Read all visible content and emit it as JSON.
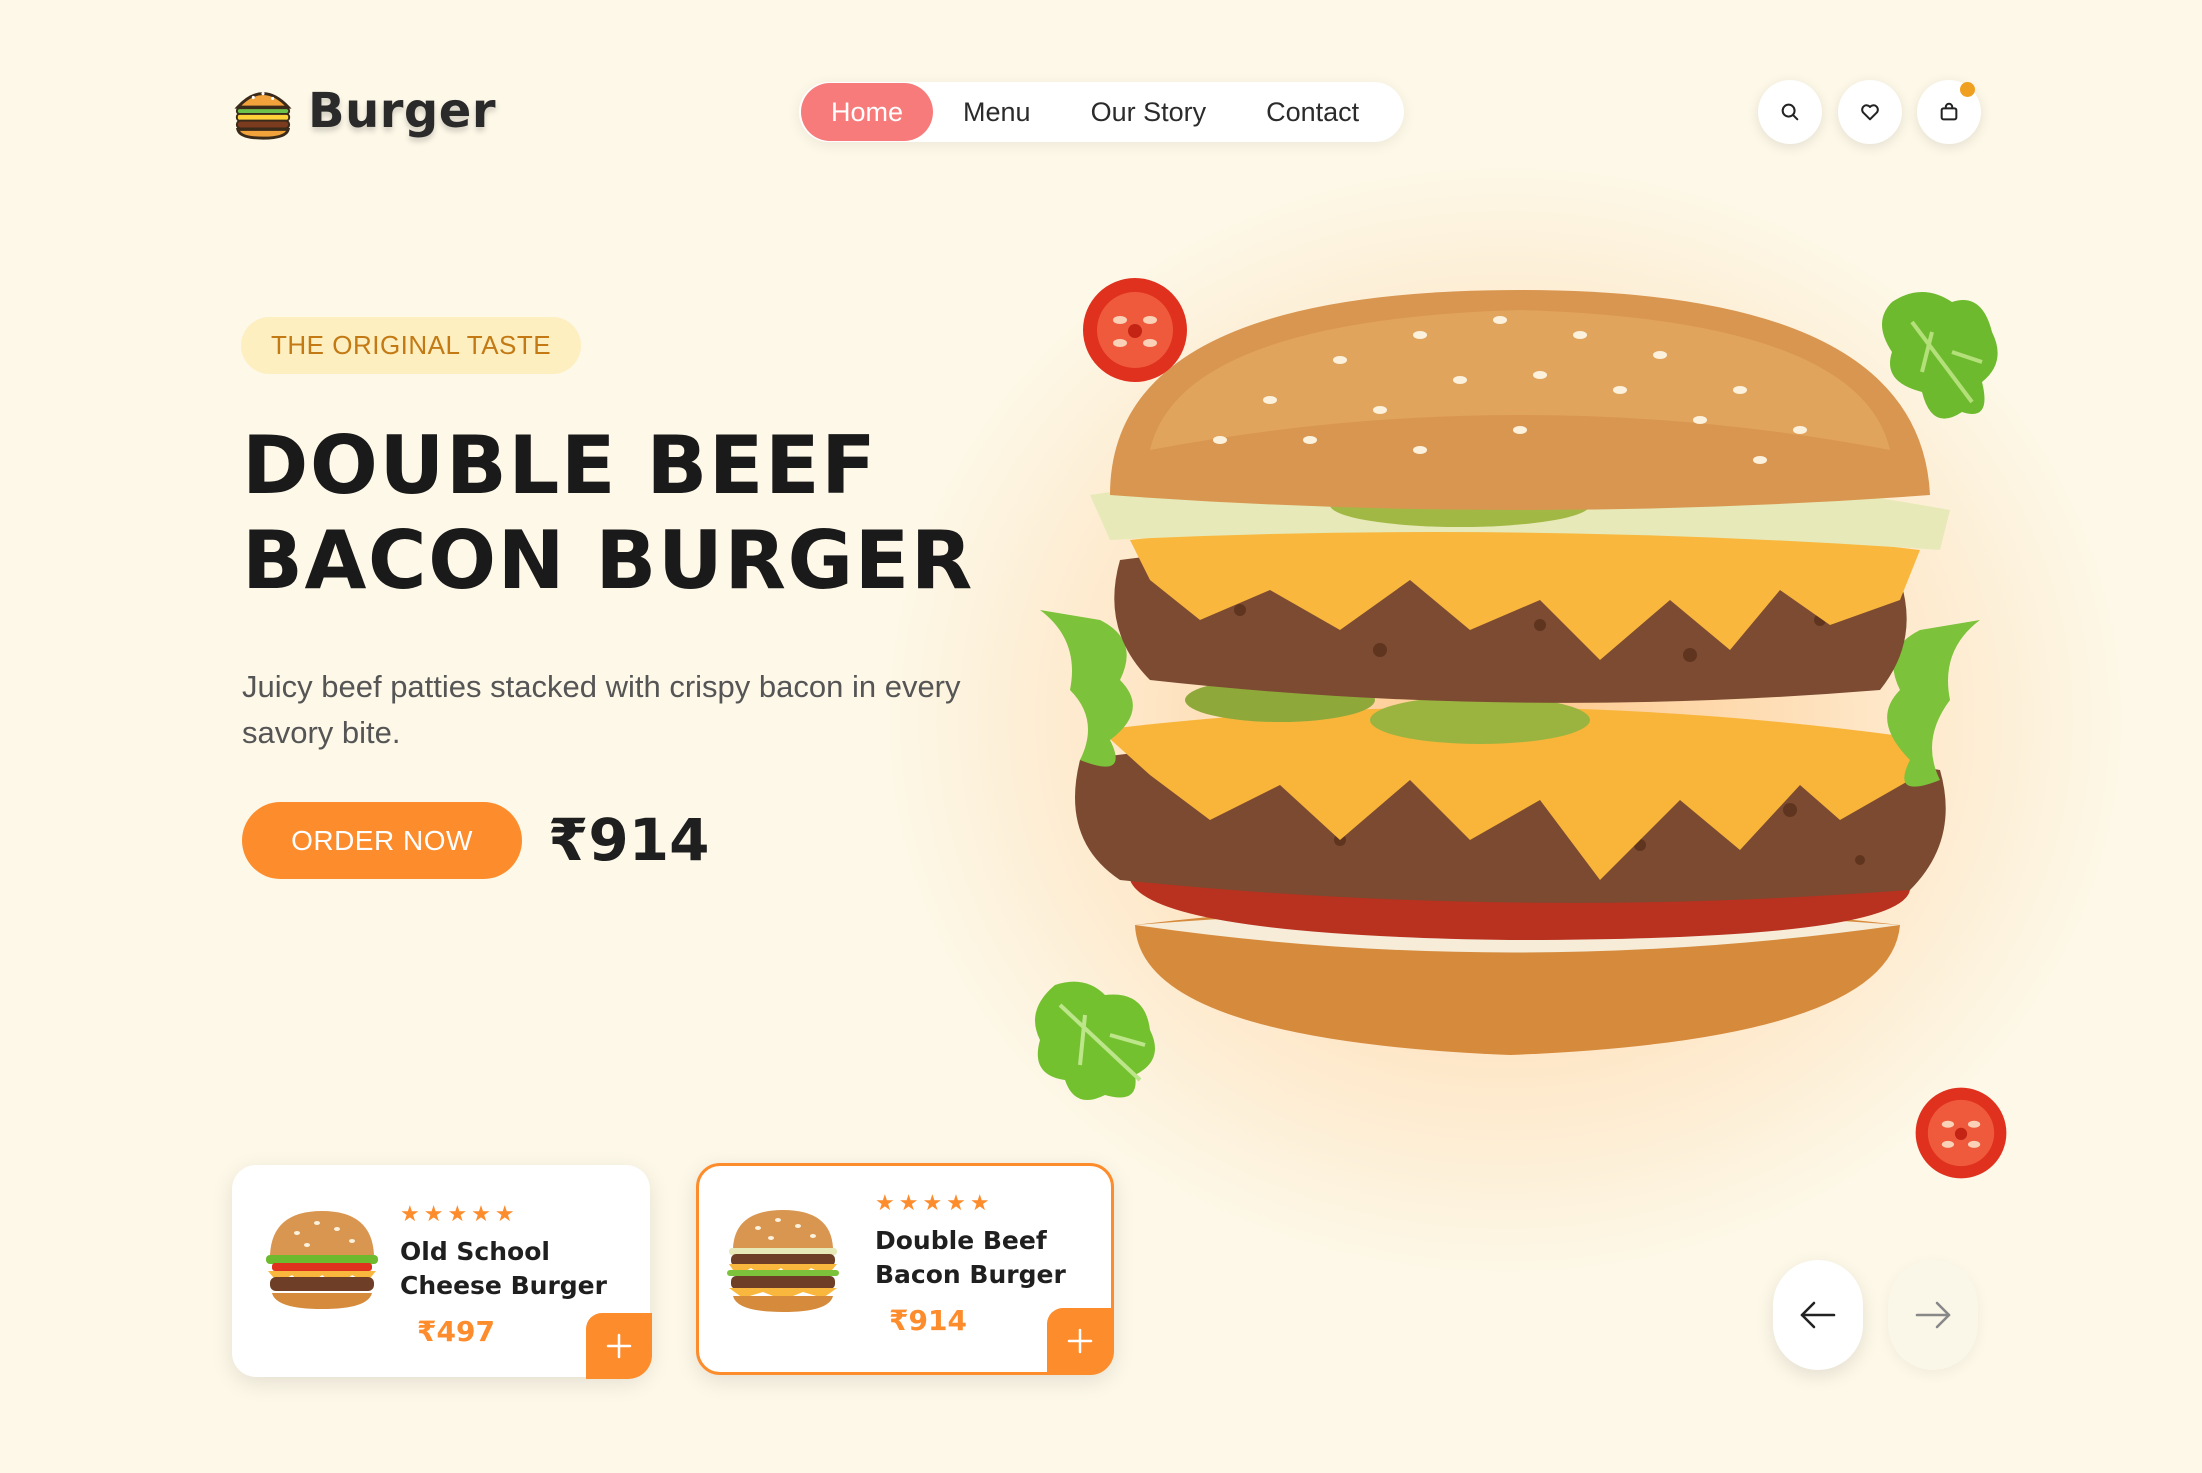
{
  "brand": {
    "name": "Burger"
  },
  "nav": {
    "items": [
      {
        "label": "Home",
        "active": true
      },
      {
        "label": "Menu",
        "active": false
      },
      {
        "label": "Our Story",
        "active": false
      },
      {
        "label": "Contact",
        "active": false
      }
    ]
  },
  "header_icons": [
    "search-icon",
    "heart-icon",
    "shopping-bag-icon"
  ],
  "hero": {
    "badge": "THE ORIGINAL TASTE",
    "title_line1": "DOUBLE BEEF",
    "title_line2": "BACON BURGER",
    "description": "Juicy beef patties stacked with crispy bacon in every savory bite.",
    "cta_label": "ORDER NOW",
    "price": "₹914"
  },
  "products": [
    {
      "name_line1": "Old School",
      "name_line2": "Cheese Burger",
      "price": "₹497",
      "rating": 5,
      "stars": "★★★★★",
      "selected": false
    },
    {
      "name_line1": "Double Beef",
      "name_line2": "Bacon Burger",
      "price": "₹914",
      "rating": 5,
      "stars": "★★★★★",
      "selected": true
    }
  ],
  "colors": {
    "background": "#fdf8e8",
    "accent_orange": "#fd8c2c",
    "nav_active": "#f77b7b",
    "badge_bg": "#fdefc0",
    "badge_text": "#c37a15",
    "cart_dot": "#f0a020"
  }
}
